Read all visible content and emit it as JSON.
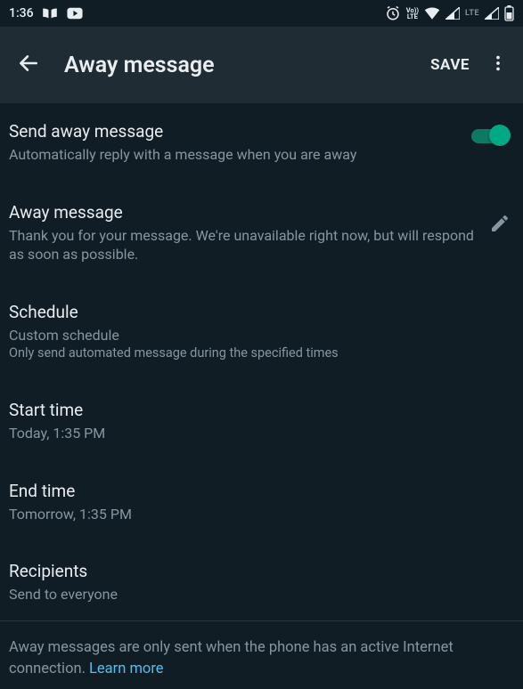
{
  "status_bar": {
    "time": "1:36",
    "lte_label": "LTE"
  },
  "app_bar": {
    "title": "Away message",
    "save_label": "SAVE"
  },
  "settings": {
    "send_away": {
      "title": "Send away message",
      "subtitle": "Automatically reply with a message when you are away",
      "enabled": true
    },
    "away_message": {
      "title": "Away message",
      "text": "Thank you for your message. We're unavailable right now, but will respond as soon as possible."
    },
    "schedule": {
      "title": "Schedule",
      "value": "Custom schedule",
      "hint": "Only send automated message during the specified times"
    },
    "start_time": {
      "title": "Start time",
      "value": "Today, 1:35 PM"
    },
    "end_time": {
      "title": "End time",
      "value": "Tomorrow, 1:35 PM"
    },
    "recipients": {
      "title": "Recipients",
      "value": "Send to everyone"
    }
  },
  "footer": {
    "text": "Away messages are only sent when the phone has an active Internet connection. ",
    "link": "Learn more"
  }
}
